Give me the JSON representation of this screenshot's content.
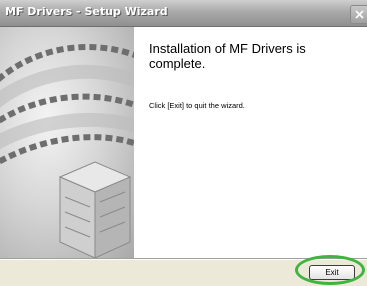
{
  "window": {
    "title": "MF Drivers - Setup Wizard"
  },
  "main": {
    "heading": "Installation of MF Drivers is complete.",
    "instruction": "Click [Exit] to quit the wizard."
  },
  "footer": {
    "exit_label": "Exit"
  },
  "colors": {
    "highlight_ring": "#3fb43f",
    "titlebar": "#a9a9a9"
  },
  "icons": {
    "close": "close-icon",
    "graphic": "wizard-graphic"
  }
}
